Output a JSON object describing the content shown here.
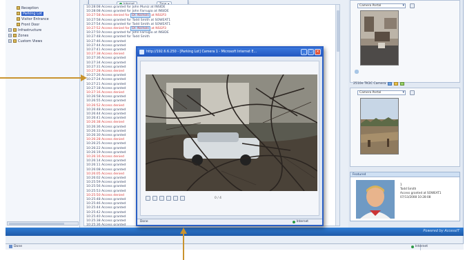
{
  "popup": {
    "left_button": "Internet",
    "right_button": "Zone"
  },
  "sidebar": {
    "items": [
      {
        "label": "Reception",
        "selected": false,
        "indent": 1,
        "expander": ""
      },
      {
        "label": "Parking Lot",
        "selected": true,
        "indent": 1,
        "expander": ""
      },
      {
        "label": "Visitor Entrance",
        "selected": false,
        "indent": 1,
        "expander": ""
      },
      {
        "label": "Front Door",
        "selected": false,
        "indent": 1,
        "expander": ""
      },
      {
        "label": "Infrastructure",
        "selected": false,
        "indent": 0,
        "expander": "+"
      },
      {
        "label": "Zones",
        "selected": false,
        "indent": 0,
        "expander": "+"
      },
      {
        "label": "Custom Views",
        "selected": false,
        "indent": 0,
        "expander": "+"
      }
    ]
  },
  "log": {
    "rows": [
      {
        "text": "10:28:08 Access granted for John Muniz at INSIDE",
        "alert": false
      },
      {
        "text": "10:28:08 Access granted for John Farrugio at INSIDE",
        "alert": false
      },
      {
        "text": "10:27:58 Access denied for ",
        "hl": "Dr. Nichols",
        "tail": " at NSGP3",
        "alert": true
      },
      {
        "text": "10:27:58 Access granted for Todd Smith at SOWEAT1",
        "alert": false
      },
      {
        "text": "10:27:54 Access granted for Todd Smith at SOWEAT1",
        "alert": false
      },
      {
        "text": "10:27:52 Access denied for ",
        "hl": "Dr. Nichols",
        "tail": " at NSGP3",
        "alert": true
      },
      {
        "text": "10:27:50 Access granted for John Farrugio at INSIDE",
        "alert": false
      },
      {
        "text": "10:27:48 Access granted for Todd Smith",
        "alert": false
      },
      {
        "text": "10:27:46 Access granted",
        "alert": false
      },
      {
        "text": "10:27:44 Access granted",
        "alert": false
      },
      {
        "text": "10:27:41 Access granted",
        "alert": false
      },
      {
        "text": "10:27:38 Access denied",
        "alert": true
      },
      {
        "text": "10:27:36 Access granted",
        "alert": false
      },
      {
        "text": "10:27:34 Access granted",
        "alert": false
      },
      {
        "text": "10:27:31 Access granted",
        "alert": false
      },
      {
        "text": "10:27:28 Access denied",
        "alert": true
      },
      {
        "text": "10:27:26 Access granted",
        "alert": false
      },
      {
        "text": "10:27:24 Access granted",
        "alert": false
      },
      {
        "text": "10:27:21 Access granted",
        "alert": false
      },
      {
        "text": "10:27:18 Access granted",
        "alert": false
      },
      {
        "text": "10:27:16 Access denied",
        "alert": true
      },
      {
        "text": "10:26:58 Access granted",
        "alert": false
      },
      {
        "text": "10:26:55 Access granted",
        "alert": false
      },
      {
        "text": "10:26:52 Access denied",
        "alert": true
      },
      {
        "text": "10:26:48 Access granted",
        "alert": false
      },
      {
        "text": "10:26:44 Access granted",
        "alert": false
      },
      {
        "text": "10:26:41 Access granted",
        "alert": false
      },
      {
        "text": "10:26:38 Access denied",
        "alert": true
      },
      {
        "text": "10:26:36 Access granted",
        "alert": false
      },
      {
        "text": "10:26:33 Access granted",
        "alert": false
      },
      {
        "text": "10:26:30 Access granted",
        "alert": false
      },
      {
        "text": "10:26:28 Access denied",
        "alert": true
      },
      {
        "text": "10:26:25 Access granted",
        "alert": false
      },
      {
        "text": "10:26:22 Access granted",
        "alert": false
      },
      {
        "text": "10:26:19 Access granted",
        "alert": false
      },
      {
        "text": "10:26:16 Access denied",
        "alert": true
      },
      {
        "text": "10:26:14 Access granted",
        "alert": false
      },
      {
        "text": "10:26:11 Access granted",
        "alert": false
      },
      {
        "text": "10:26:08 Access granted",
        "alert": false
      },
      {
        "text": "10:26:05 Access denied",
        "alert": true
      },
      {
        "text": "10:26:02 Access granted",
        "alert": false
      },
      {
        "text": "10:25:59 Access granted",
        "alert": false
      },
      {
        "text": "10:25:56 Access granted",
        "alert": false
      },
      {
        "text": "10:25:53 Access granted",
        "alert": false
      },
      {
        "text": "10:25:50 Access denied",
        "alert": true
      },
      {
        "text": "10:25:48 Access granted",
        "alert": false
      },
      {
        "text": "10:25:46 Access granted",
        "alert": false
      },
      {
        "text": "10:25:44 Access granted",
        "alert": false
      },
      {
        "text": "10:25:42 Access granted",
        "alert": false
      },
      {
        "text": "10:25:40 Access granted",
        "alert": false
      },
      {
        "text": "10:25:38 Access granted",
        "alert": false
      },
      {
        "text": "10:25:36 Access granted",
        "alert": false
      }
    ]
  },
  "right_panel": {
    "camera1_select": "Camera Portal",
    "camera2_label": "2510e TK3C Camera",
    "camera2_select": "Camera Portal"
  },
  "person_card": {
    "header": "Featured",
    "id": "1",
    "name": "Todd Smith",
    "line1": "Access granted at SOWEAT1",
    "line2": "07/13/2008 10:28:08"
  },
  "video_window": {
    "title": "http://192.6.6.250 - [Parking Lot] Camera 1 - Microsoft Internet E...",
    "status_left": "Done",
    "status_right": "Internet",
    "counter": "0 / 4"
  },
  "statusbar": {
    "left": "Done",
    "right": "Internet"
  },
  "brand": "Powered by AccessIT"
}
